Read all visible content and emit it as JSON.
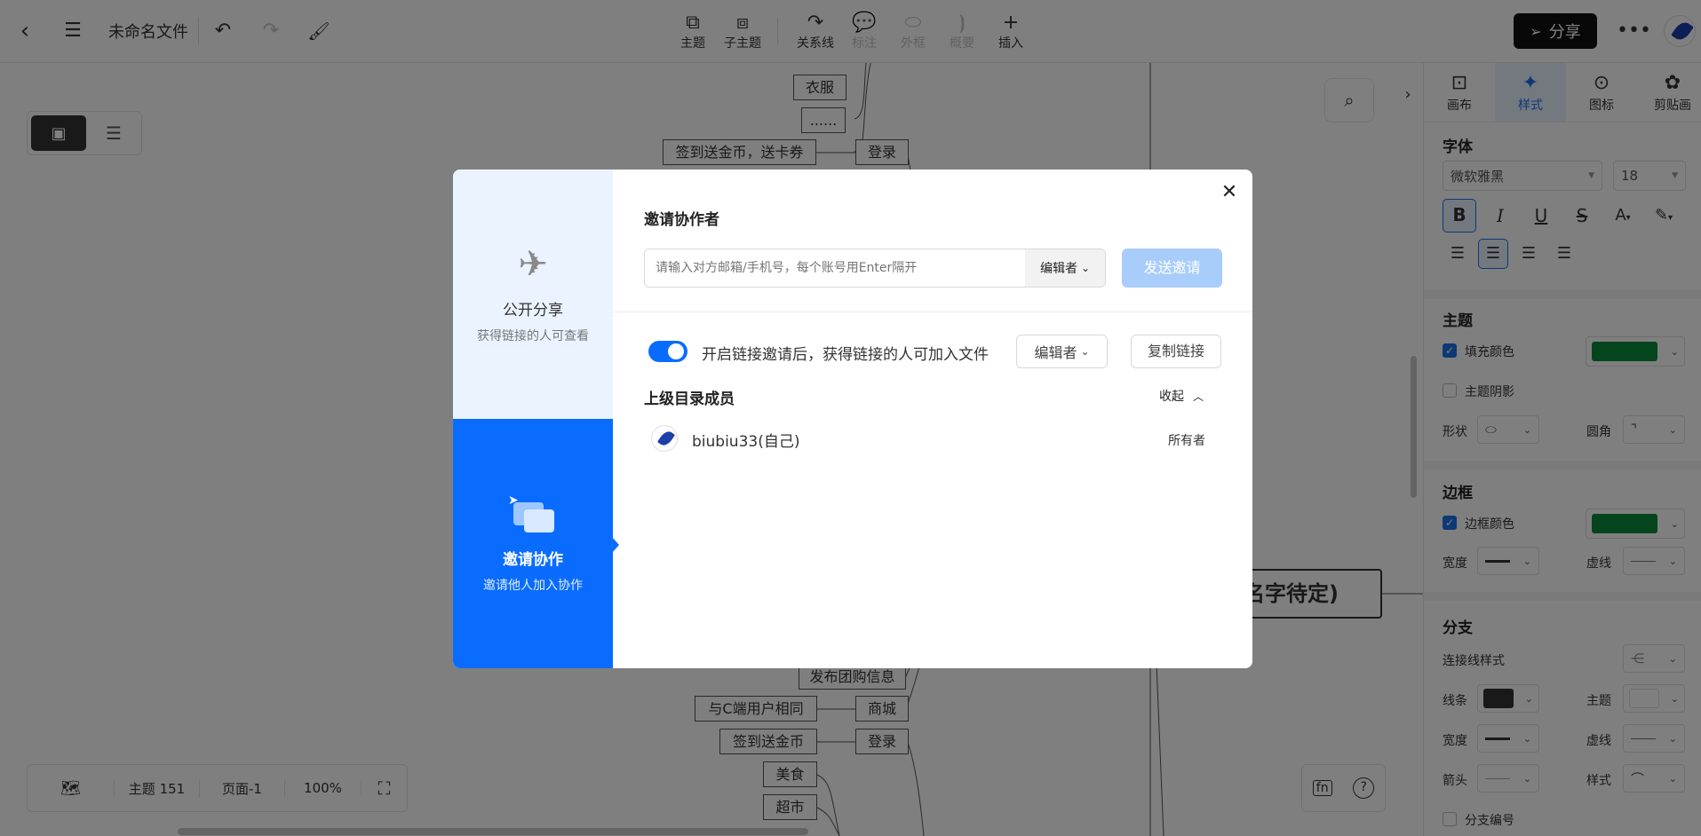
{
  "topbar": {
    "file_title": "未命名文件",
    "tools": [
      {
        "icon": "topic-icon",
        "label": "主题",
        "disabled": false
      },
      {
        "icon": "subtopic-icon",
        "label": "子主题",
        "disabled": false
      },
      {
        "icon": "relation-icon",
        "label": "关系线",
        "disabled": false
      },
      {
        "icon": "note-icon",
        "label": "标注",
        "disabled": true
      },
      {
        "icon": "frame-icon",
        "label": "外框",
        "disabled": true
      },
      {
        "icon": "summary-icon",
        "label": "概要",
        "disabled": true
      },
      {
        "icon": "insert-icon",
        "label": "插入",
        "disabled": false
      }
    ],
    "share_label": "分享"
  },
  "canvas": {
    "nodes": [
      "衣服",
      "......",
      "签到送金币，送卡券",
      "登录",
      "发布团购信息",
      "与C端用户相同",
      "商城",
      "签到送金币",
      "登录",
      "美食",
      "超市",
      "名字待定)"
    ]
  },
  "statusbar": {
    "topic_count": "主题 151",
    "page": "页面-1",
    "zoom": "100%"
  },
  "right_panel": {
    "tabs": [
      {
        "icon": "canvas-icon",
        "label": "画布"
      },
      {
        "icon": "style-icon",
        "label": "样式",
        "active": true
      },
      {
        "icon": "icon-icon",
        "label": "图标"
      },
      {
        "icon": "clipboard-icon",
        "label": "剪贴画"
      }
    ],
    "font": {
      "title": "字体",
      "family": "微软雅黑",
      "size": "18"
    },
    "topic": {
      "title": "主题",
      "fill_label": "填充颜色",
      "fill_color": "#0a8a3c",
      "shadow_label": "主题阴影",
      "shape_label": "形状",
      "corner_label": "圆角"
    },
    "border": {
      "title": "边框",
      "color_label": "边框颜色",
      "color": "#0a8a3c",
      "width_label": "宽度",
      "dash_label": "虚线"
    },
    "branch": {
      "title": "分支",
      "line_style_label": "连接线样式",
      "line_label": "线条",
      "line_color": "#333333",
      "topic_label": "主题",
      "width_label": "宽度",
      "dash_label": "虚线",
      "arrow_label": "箭头",
      "style_label": "样式",
      "numbering_label": "分支编号"
    }
  },
  "modal": {
    "side": {
      "public": {
        "title": "公开分享",
        "subtitle": "获得链接的人可查看"
      },
      "invite": {
        "title": "邀请协作",
        "subtitle": "邀请他人加入协作"
      }
    },
    "title": "邀请协作者",
    "input_placeholder": "请输入对方邮箱/手机号，每个账号用Enter隔开",
    "role_select": "编辑者",
    "send_label": "发送邀请",
    "link_toggle_text": "开启链接邀请后，获得链接的人可加入文件",
    "link_role": "编辑者",
    "copy_link_label": "复制链接",
    "members_title": "上级目录成员",
    "collapse_label": "收起",
    "members": [
      {
        "name": "biubiu33(自己)",
        "role": "所有者"
      }
    ]
  },
  "colors": {
    "accent": "#0a6cff",
    "send_disabled": "#a9cdfb"
  }
}
